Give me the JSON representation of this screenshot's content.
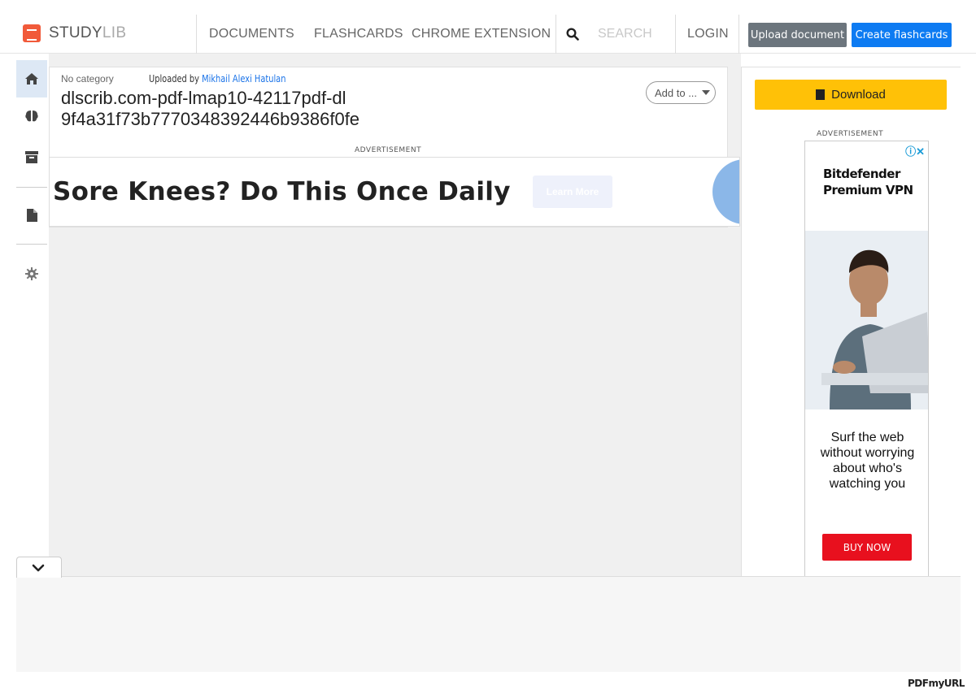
{
  "header": {
    "logo_study": "STUDY",
    "logo_lib": "LIB",
    "nav": [
      "DOCUMENTS",
      "FLASHCARDS",
      "CHROME EXTENSION"
    ],
    "search_placeholder": "SEARCH",
    "login": "LOGIN",
    "upload_label": "Upload document",
    "create_label": "Create flashcards"
  },
  "sidebar": {
    "icons": [
      "home-icon",
      "brain-icon",
      "archive-icon",
      "file-icon",
      "gear-icon"
    ]
  },
  "document": {
    "category": "No category",
    "uploaded_prefix": "Uploaded by ",
    "uploader": "Mikhail Alexi Hatulan",
    "title": "dlscrib.com-pdf-lmap10-42117pdf-dl 9f4a31f73b7770348392446b9386f0fe",
    "add_to_label": "Add to ..."
  },
  "ads": {
    "label": "ADVERTISEMENT",
    "banner_headline": "Sore Knees? Do This Once Daily",
    "banner_cta": "Learn More",
    "side_brand_line1": "Bitdefender",
    "side_brand_line2": "Premium VPN",
    "side_tagline": "Surf the web without worrying about who's watching you",
    "side_cta": "BUY NOW"
  },
  "right": {
    "download_label": "Download"
  },
  "footer": {
    "watermark": "PDFmyURL"
  },
  "colors": {
    "brand": "#f15a3a",
    "upload_btn": "#6c757d",
    "create_btn": "#0d7bf2",
    "download_btn": "#ffc107",
    "buy_btn": "#e8101e",
    "link": "#1a73e8"
  }
}
